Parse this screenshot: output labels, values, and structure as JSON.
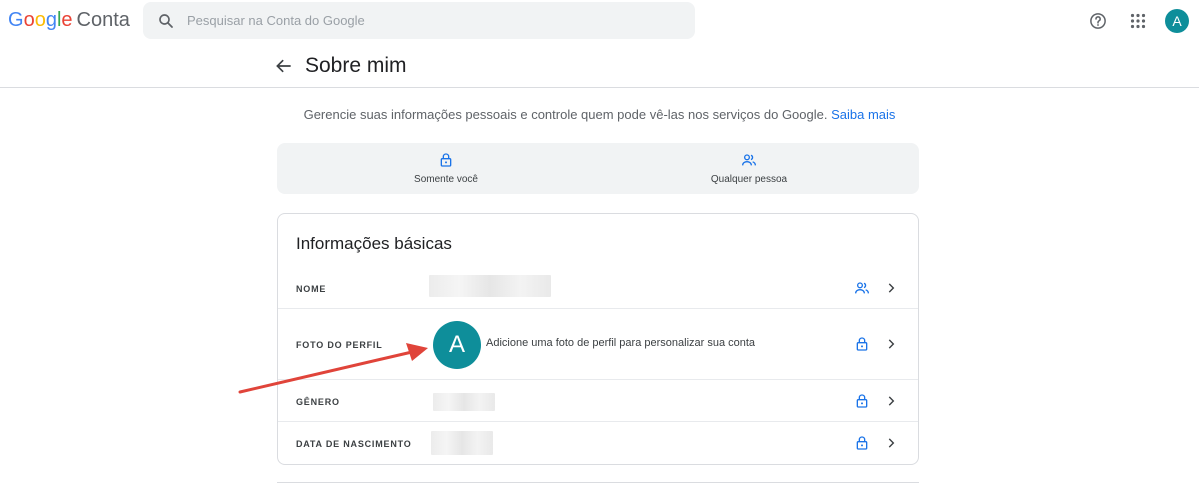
{
  "header": {
    "logo_google": "Google",
    "logo_conta": "Conta",
    "search_placeholder": "Pesquisar na Conta do Google",
    "avatar_letter": "A"
  },
  "page": {
    "title": "Sobre mim",
    "intro_text": "Gerencie suas informações pessoais e controle quem pode vê-las nos serviços do Google.",
    "intro_link": "Saiba mais"
  },
  "legend": {
    "only_you": "Somente você",
    "anyone": "Qualquer pessoa"
  },
  "card": {
    "title": "Informações básicas",
    "rows": [
      {
        "label": "NOME",
        "visibility": "people-icon"
      },
      {
        "label": "FOTO DO PERFIL",
        "visibility": "lock-icon",
        "avatar_letter": "A",
        "text": "Adicione uma foto de perfil para personalizar sua conta"
      },
      {
        "label": "GÊNERO",
        "visibility": "lock-icon"
      },
      {
        "label": "DATA DE NASCIMENTO",
        "visibility": "lock-icon"
      }
    ]
  },
  "colors": {
    "accent_blue": "#1a73e8",
    "avatar_teal": "#0e8e9a",
    "annotation_red": "#e0443a"
  }
}
